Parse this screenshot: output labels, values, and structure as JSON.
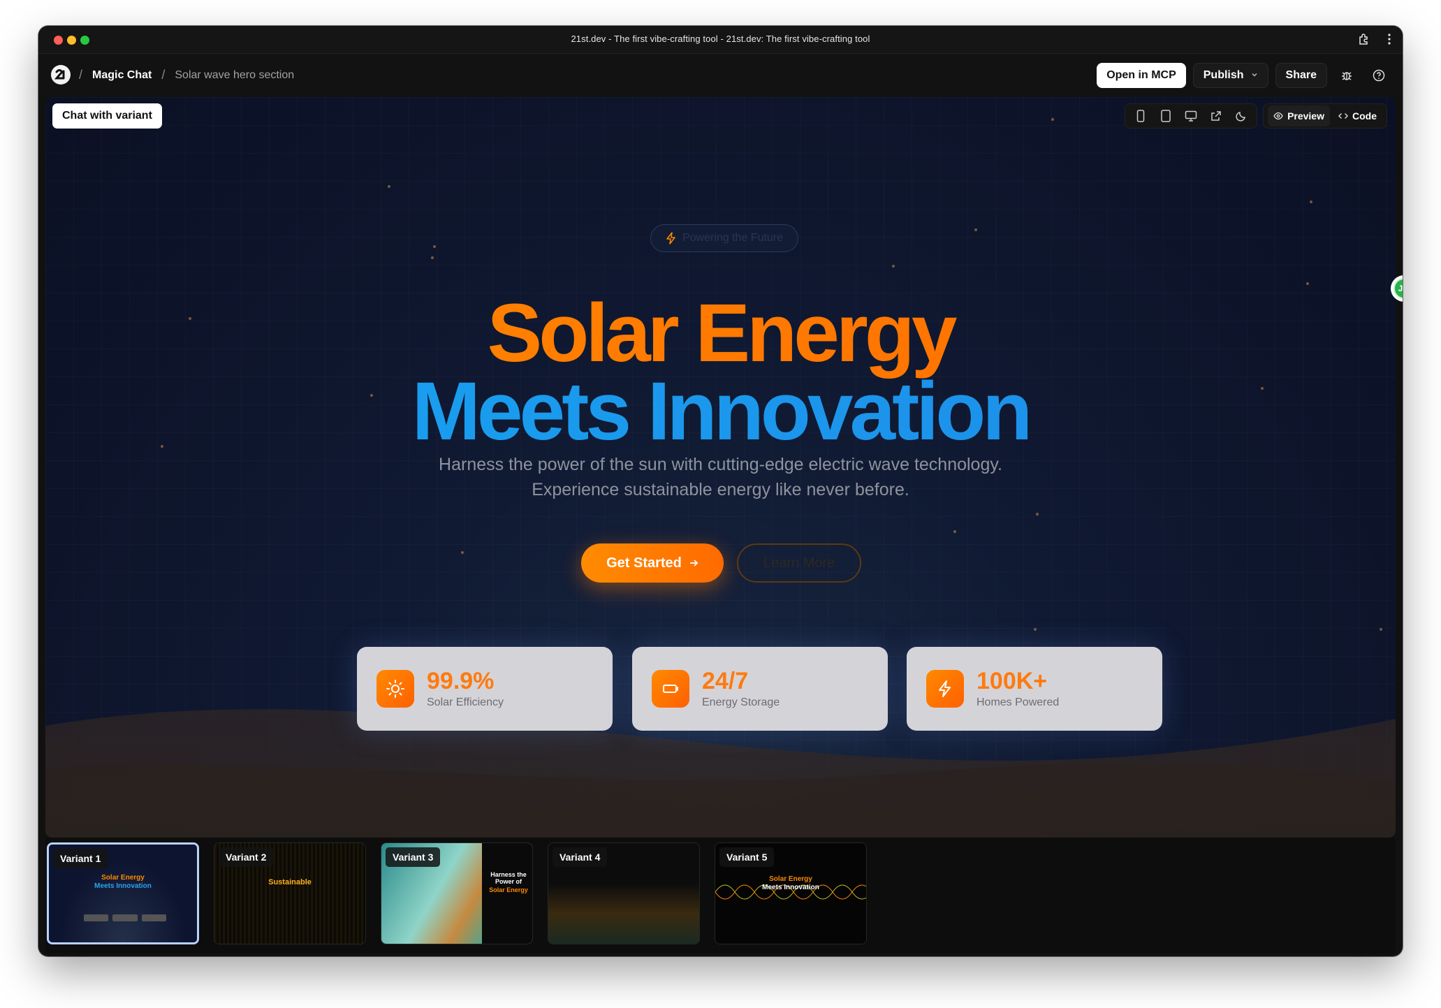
{
  "window": {
    "title": "21st.dev - The first vibe-crafting tool - 21st.dev: The first vibe-crafting tool"
  },
  "breadcrumb": {
    "app": "Magic Chat",
    "page": "Solar wave hero section",
    "separator": "/"
  },
  "actions": {
    "open_mcp": "Open in MCP",
    "publish": "Publish",
    "share": "Share"
  },
  "canvas_toolbar": {
    "chat_with_variant": "Chat with variant",
    "preview": "Preview",
    "code": "Code"
  },
  "hero": {
    "badge": "Powering the Future",
    "title_line1": "Solar Energy",
    "title_line2": "Meets Innovation",
    "subtitle_line1": "Harness the power of the sun with cutting-edge electric wave technology.",
    "subtitle_line2": "Experience sustainable energy like never before.",
    "primary_cta": "Get Started",
    "secondary_cta": "Learn More"
  },
  "stats": [
    {
      "value": "99.9%",
      "label": "Solar Efficiency",
      "icon": "sun-icon"
    },
    {
      "value": "24/7",
      "label": "Energy Storage",
      "icon": "battery-icon"
    },
    {
      "value": "100K+",
      "label": "Homes Powered",
      "icon": "bolt-icon"
    }
  ],
  "avatar": {
    "initials": "JM"
  },
  "variants": [
    {
      "label": "Variant 1",
      "line1": "Solar Energy",
      "line2": "Meets Innovation"
    },
    {
      "label": "Variant 2",
      "line1": "Sustainable",
      "line2": ""
    },
    {
      "label": "Variant 3",
      "line1": "Harness the Power of",
      "line2": "Solar Energy"
    },
    {
      "label": "Variant 4",
      "line1": "",
      "line2": ""
    },
    {
      "label": "Variant 5",
      "line1": "Solar Energy",
      "line2": "Meets Innovation"
    }
  ],
  "colors": {
    "orange": "#ff7a00",
    "blue": "#1e9be8",
    "bg": "#0b1024"
  }
}
